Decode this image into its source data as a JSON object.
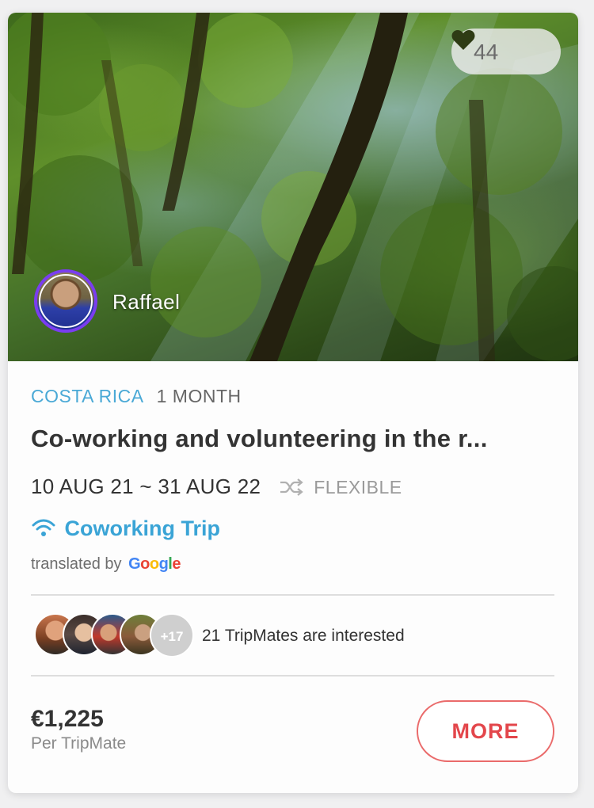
{
  "hero": {
    "image_alt": "rainforest",
    "likes_count": "44",
    "host_name": "Raffael"
  },
  "trip": {
    "country": "COSTA RICA",
    "duration": "1 MONTH",
    "title": "Co-working and volunteering in the r...",
    "dates": "10 AUG 21 ~ 31 AUG 22",
    "flexible_label": "FLEXIBLE",
    "type_label": "Coworking Trip",
    "translated_prefix": "translated by",
    "google_letters": [
      "G",
      "o",
      "o",
      "g",
      "l",
      "e"
    ]
  },
  "tripmates": {
    "more_count": "+17",
    "interest_text": "21 TripMates are interested"
  },
  "pricing": {
    "price": "€1,225",
    "per_label": "Per TripMate",
    "more_button": "MORE"
  },
  "colors": {
    "accent_blue": "#3aa4d6",
    "accent_red": "#e3464b",
    "avatar_ring": "#7a3df0"
  }
}
